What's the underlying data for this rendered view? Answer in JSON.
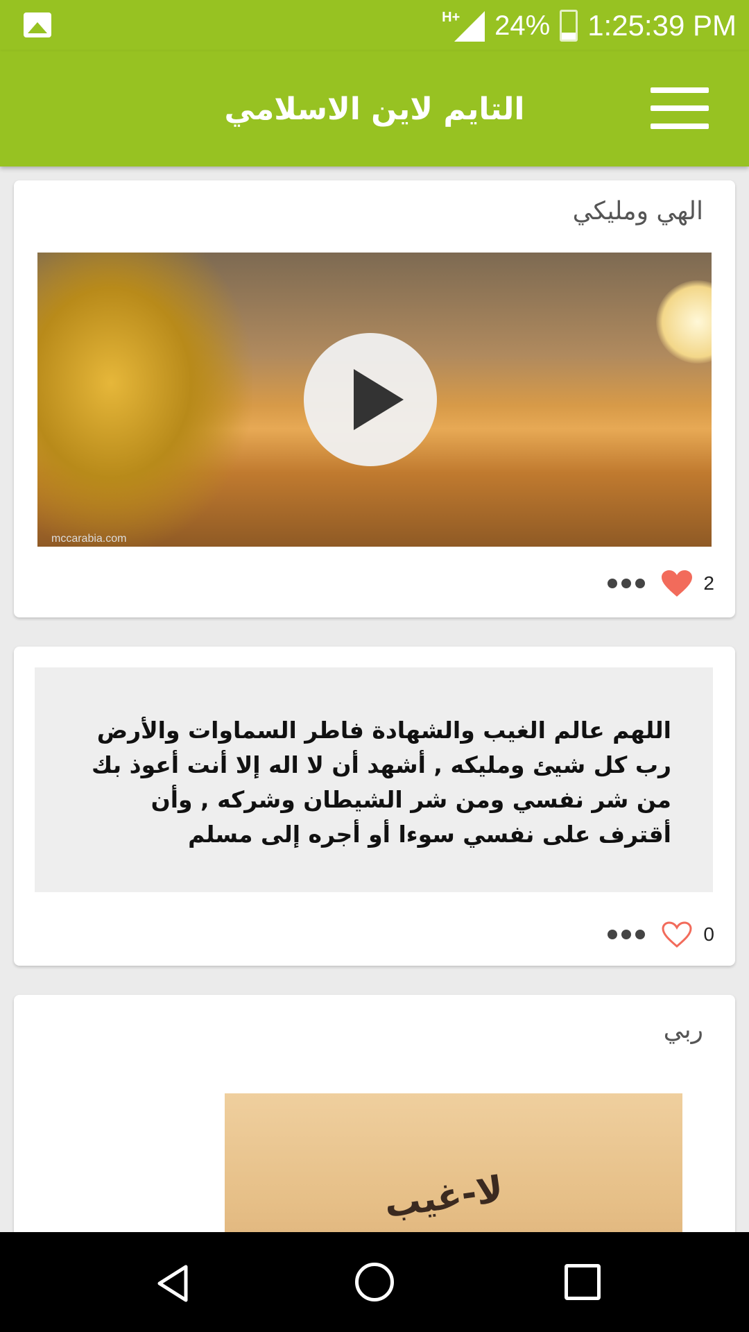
{
  "status_bar": {
    "network": "H+",
    "battery_percent": "24%",
    "battery_level": 0.24,
    "time": "1:25:39 PM",
    "notification_icon": "gallery-icon"
  },
  "app_bar": {
    "title": "التايم لاين الاسلامي",
    "menu_icon": "hamburger-menu-icon"
  },
  "feed": [
    {
      "type": "video",
      "title": "الهي ومليكي",
      "thumbnail_watermark": "mccarabia.com",
      "likes": "2",
      "liked": true
    },
    {
      "type": "text",
      "text": "اللهم عالم الغيب والشهادة فاطر السماوات والأرض رب كل شيئ ومليكه , أشهد أن لا اله إلا أنت أعوذ بك من شر نفسي ومن شر الشيطان وشركه , وأن أقترف على نفسي سوءا أو أجره إلى مسلم",
      "likes": "0",
      "liked": false
    },
    {
      "type": "image",
      "title": "ربي",
      "image_caption": "لا-غيب"
    }
  ],
  "colors": {
    "primary": "#97c222",
    "like_active": "#f26b5b",
    "like_inactive": "#f26b5b",
    "background": "#ebebeb"
  },
  "nav_bar": {
    "back_icon": "back-triangle-icon",
    "home_icon": "home-circle-icon",
    "recents_icon": "recents-square-icon"
  }
}
